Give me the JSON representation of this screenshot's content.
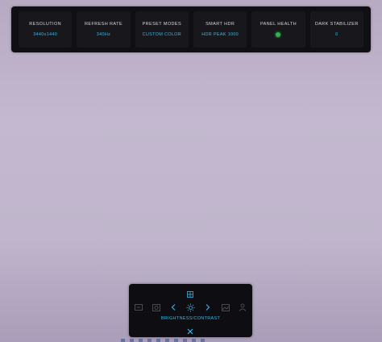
{
  "status_bar": {
    "items": [
      {
        "label": "RESOLUTION",
        "value": "3440x1440"
      },
      {
        "label": "REFRESH RATE",
        "value": "340Hz"
      },
      {
        "label": "PRESET MODES",
        "value": "CUSTOM COLOR"
      },
      {
        "label": "SMART HDR",
        "value": "HDR PEAK 1000"
      },
      {
        "label": "PANEL HEALTH",
        "value_color": "#2fb34a"
      },
      {
        "label": "DARK STABILIZER",
        "value": "0"
      }
    ]
  },
  "osd": {
    "top_icon": "menu-grid-icon",
    "nav_icons": [
      "input-source-icon",
      "color-icon",
      "chevron-left-icon",
      "brightness-icon",
      "chevron-right-icon",
      "display-icon",
      "user-icon"
    ],
    "current_label": "BRIGHTNESS/CONTRAST",
    "close_icon": "close-icon"
  },
  "colors": {
    "accent": "#38b7e6",
    "panel_bg": "#101014",
    "health_ok": "#2fb34a"
  }
}
